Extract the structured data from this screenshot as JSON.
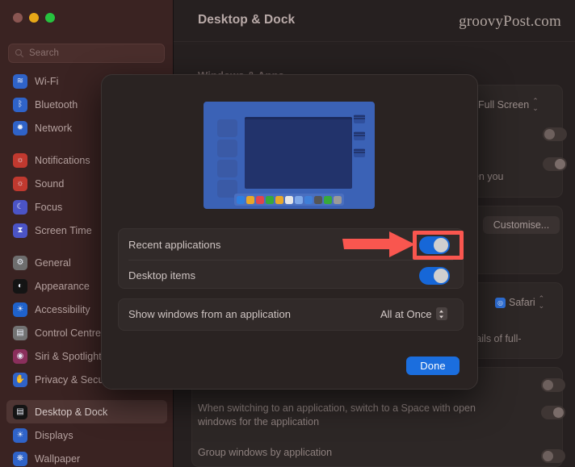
{
  "window": {
    "title": "Desktop & Dock",
    "watermark": "groovyPost.com",
    "traffic_lights": [
      "close",
      "minimize",
      "zoom"
    ]
  },
  "search": {
    "placeholder": "Search",
    "value": "",
    "icon": "search-icon"
  },
  "sidebar": {
    "groups": [
      {
        "items": [
          {
            "label": "Wi-Fi",
            "icon": "wifi-icon",
            "color": "#2f63c8",
            "glyph": "≋",
            "selected": false
          },
          {
            "label": "Bluetooth",
            "icon": "bluetooth-icon",
            "color": "#2f63c8",
            "glyph": "ᛒ",
            "selected": false
          },
          {
            "label": "Network",
            "icon": "network-icon",
            "color": "#2f63c8",
            "glyph": "✹",
            "selected": false
          }
        ]
      },
      {
        "items": [
          {
            "label": "Notifications",
            "icon": "notifications-icon",
            "color": "#c0392f",
            "glyph": "🔔",
            "selected": false
          },
          {
            "label": "Sound",
            "icon": "sound-icon",
            "color": "#c0392f",
            "glyph": "◀",
            "selected": false
          },
          {
            "label": "Focus",
            "icon": "focus-icon",
            "color": "#4b54c6",
            "glyph": "☾",
            "selected": false
          },
          {
            "label": "Screen Time",
            "icon": "screen-time-icon",
            "color": "#4b54c6",
            "glyph": "⧗",
            "selected": false
          }
        ]
      },
      {
        "items": [
          {
            "label": "General",
            "icon": "general-icon",
            "color": "#6e6e6e",
            "glyph": "⚙",
            "selected": false
          },
          {
            "label": "Appearance",
            "icon": "appearance-icon",
            "color": "#1c1c1c",
            "glyph": "◐",
            "selected": false
          },
          {
            "label": "Accessibility",
            "icon": "accessibility-icon",
            "color": "#1f62cc",
            "glyph": "♿",
            "selected": false
          },
          {
            "label": "Control Centre",
            "icon": "control-centre-icon",
            "color": "#737373",
            "glyph": "▤",
            "selected": false
          },
          {
            "label": "Siri & Spotlight",
            "icon": "siri-spotlight-icon",
            "color": "#8a2f5c",
            "glyph": "◉",
            "selected": false
          },
          {
            "label": "Privacy & Security",
            "icon": "privacy-security-icon",
            "color": "#2f63c8",
            "glyph": "✋",
            "selected": false
          }
        ]
      },
      {
        "items": [
          {
            "label": "Desktop & Dock",
            "icon": "desktop-dock-icon",
            "color": "#1a1a1a",
            "glyph": "▭",
            "selected": true
          },
          {
            "label": "Displays",
            "icon": "displays-icon",
            "color": "#2f63c8",
            "glyph": "☀",
            "selected": false
          },
          {
            "label": "Wallpaper",
            "icon": "wallpaper-icon",
            "color": "#2f63c8",
            "glyph": "❋",
            "selected": false
          }
        ]
      }
    ]
  },
  "background": {
    "section_title": "Windows & Apps",
    "full_screen_popup": "Full Screen",
    "toggle_when_you_text": "when you",
    "customise_button": "Customise...",
    "safari_popup": "Safari",
    "thumbnails_text": "mbnails of full-",
    "partial_label_e": "e",
    "switch_space_text": "When switching to an application, switch to a Space with open windows for the application",
    "group_windows_text": "Group windows by application",
    "with_open_text": "with open"
  },
  "modal": {
    "preview": {
      "name": "mission-control-preview",
      "dock_icons": [
        "#2f7fe0",
        "#e8a82a",
        "#e0454f",
        "#37a93c",
        "#e8a82a",
        "#e6e6e6",
        "#7fa8e8",
        "#3f7fd8",
        "#555555",
        "#37a93c",
        "#9a9a9a"
      ],
      "side_windows": 4,
      "right_windows": 3
    },
    "rows": [
      {
        "label": "Recent applications",
        "control": "toggle",
        "value": "on",
        "highlighted": true
      },
      {
        "label": "Desktop items",
        "control": "toggle",
        "value": "on",
        "highlighted": false
      }
    ],
    "popup_row": {
      "label": "Show windows from an application",
      "value": "All at Once"
    },
    "done_label": "Done"
  },
  "annotation": {
    "arrow_color": "#f9564f",
    "highlight_color": "#f9564f",
    "points_to": "Recent applications toggle"
  }
}
